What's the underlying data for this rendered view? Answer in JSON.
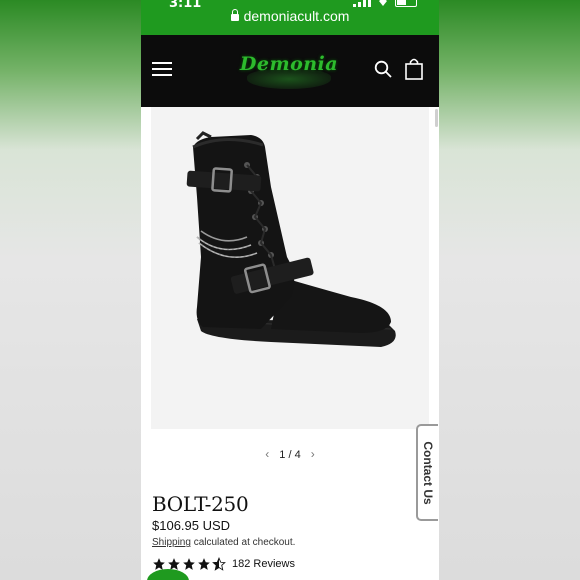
{
  "status_bar": {
    "time": "3:11",
    "url": "demoniacult.com"
  },
  "nav": {
    "logo_text": "Demonia",
    "icons": [
      "hamburger-icon",
      "search-icon",
      "shopping-bag-icon"
    ]
  },
  "gallery": {
    "current": "1",
    "separator": "/",
    "total": "4",
    "prev_icon": "‹",
    "next_icon": "›"
  },
  "product": {
    "name": "BOLT-250",
    "price": "$106.95 USD",
    "shipping_link": "Shipping",
    "shipping_text": " calculated at checkout.",
    "rating": 4.5,
    "reviews_label": "182 Reviews"
  },
  "contact_tab": {
    "label": "Contact Us"
  },
  "colors": {
    "status_green": "#1f9a1f",
    "nav_black": "#0c0c0c",
    "logo_green": "#2dbb2d"
  }
}
